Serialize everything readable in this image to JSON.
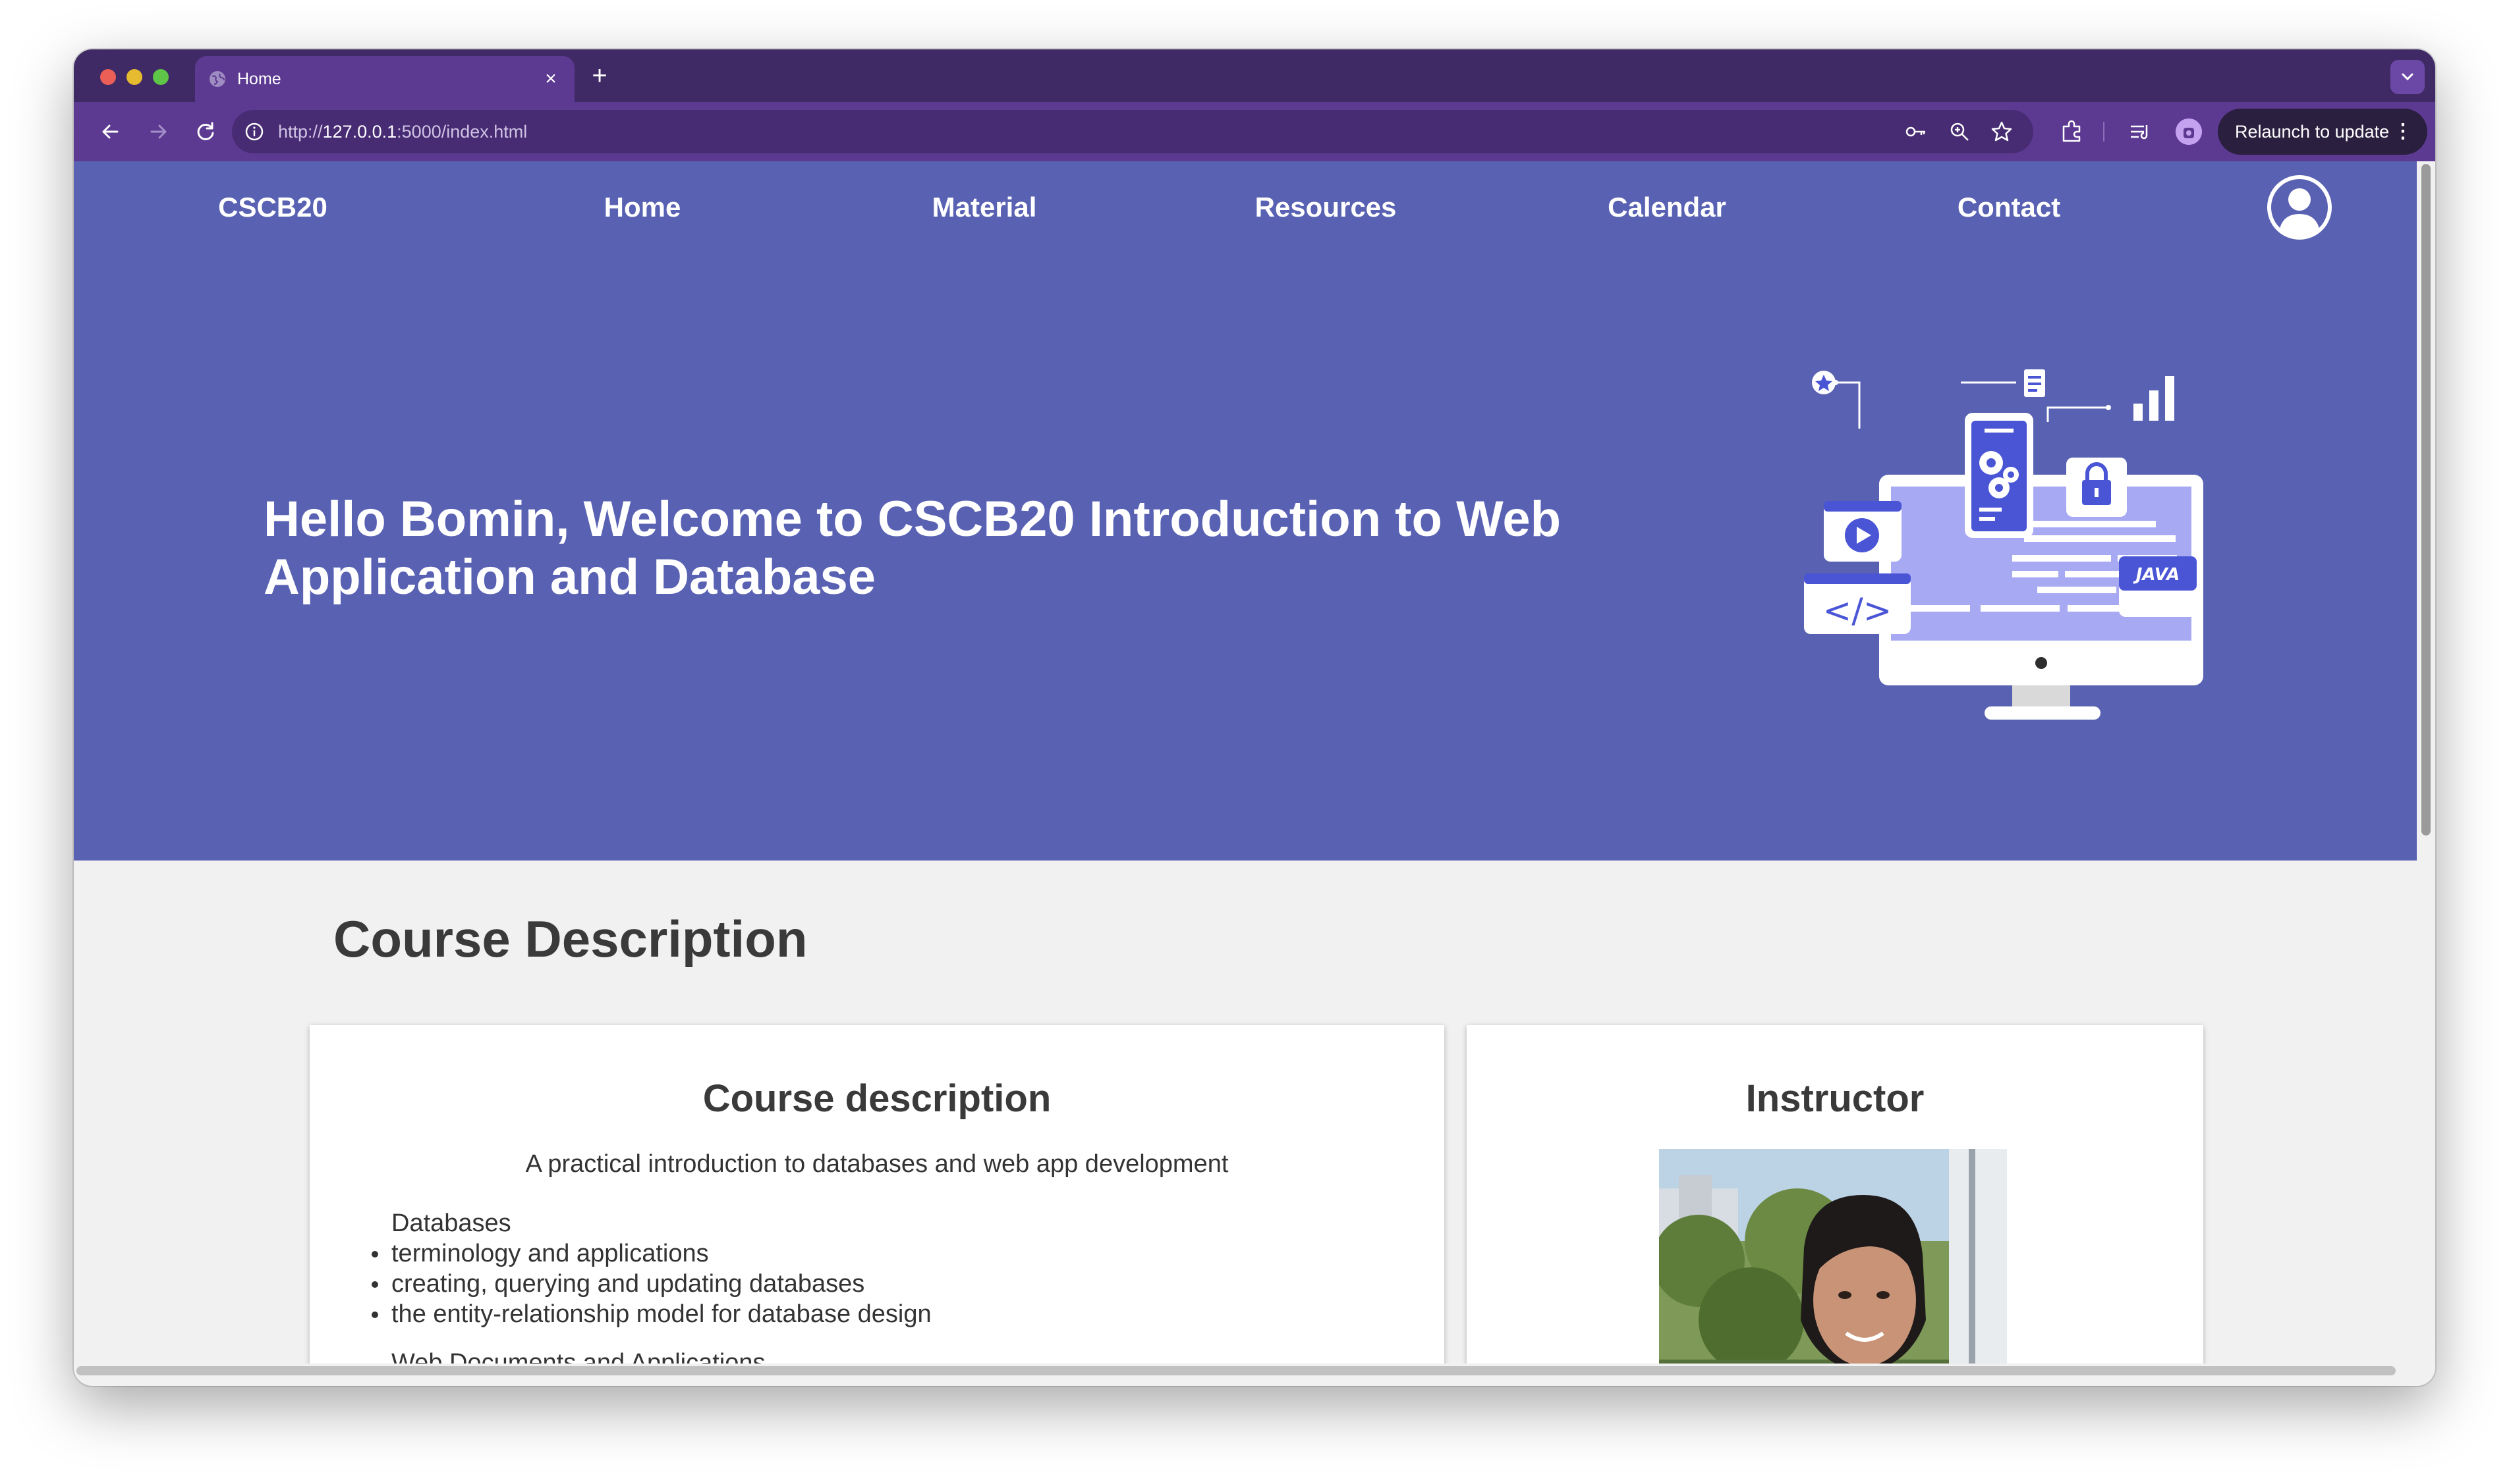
{
  "browser": {
    "tab_title": "Home",
    "url_prefix": "http://",
    "url_host": "127.0.0.1",
    "url_rest": ":5000/index.html",
    "relaunch_label": "Relaunch to update"
  },
  "site": {
    "brand": "CSCB20",
    "nav": [
      "Home",
      "Material",
      "Resources",
      "Calendar",
      "Contact"
    ]
  },
  "hero": {
    "title_line1": "Hello Bomin, Welcome to CSCB20 Introduction to Web",
    "title_line2": "Application and Database",
    "illustration_code": "</>",
    "illustration_tag": "JAVA"
  },
  "section": {
    "title": "Course Description"
  },
  "course_card": {
    "title": "Course description",
    "subtitle": "A practical introduction to databases and web app development",
    "heading1": "Databases",
    "items": [
      "terminology and applications",
      "creating, querying and updating databases",
      "the entity-relationship model for database design"
    ],
    "heading2": "Web Documents and Applications"
  },
  "instructor_card": {
    "title": "Instructor"
  },
  "colors": {
    "hero_bg": "#5961b3",
    "tabstrip_bg": "#3f2a66",
    "toolbar_bg": "#5c3a91",
    "page_bg": "#f1f1f1"
  }
}
